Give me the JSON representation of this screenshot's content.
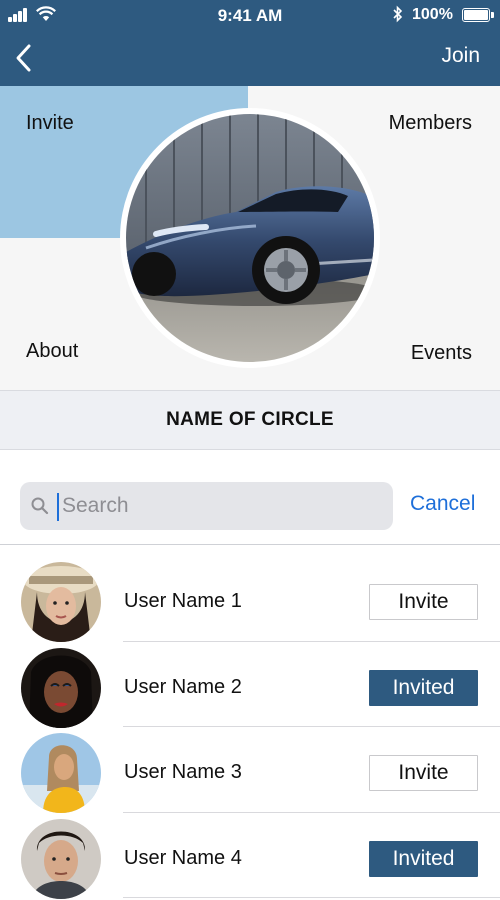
{
  "status_bar": {
    "time": "9:41 AM",
    "battery": "100%",
    "battery_level": 1.0,
    "icons": [
      "signal-icon",
      "wifi-icon",
      "bluetooth-icon",
      "battery-icon"
    ]
  },
  "nav": {
    "back_icon": "chevron-left-icon",
    "join_label": "Join"
  },
  "circle": {
    "quadrants": {
      "invite": "Invite",
      "members": "Members",
      "about": "About",
      "events": "Events"
    },
    "name": "NAME OF CIRCLE"
  },
  "search": {
    "placeholder": "Search",
    "value": "",
    "cancel_label": "Cancel"
  },
  "users": [
    {
      "name": "User Name 1",
      "action": "Invite",
      "state": "default"
    },
    {
      "name": "User Name 2",
      "action": "Invited",
      "state": "invited"
    },
    {
      "name": "User Name 3",
      "action": "Invite",
      "state": "default"
    },
    {
      "name": "User Name 4",
      "action": "Invited",
      "state": "invited"
    }
  ],
  "colors": {
    "primary": "#2e5a80",
    "invite_quadrant": "#9cc6e2",
    "link": "#1e6fd9",
    "search_field": "#e4e5e9"
  }
}
